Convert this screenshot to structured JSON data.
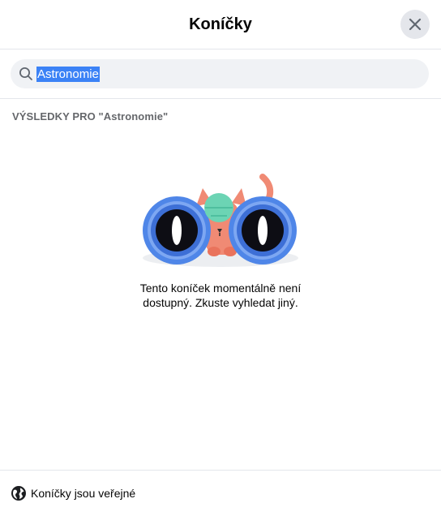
{
  "header": {
    "title": "Koníčky",
    "close_icon": "close-icon"
  },
  "search": {
    "value": "Astronomie",
    "icon": "search-icon"
  },
  "results": {
    "label": "VÝSLEDKY PRO \"Astronomie\""
  },
  "empty_state": {
    "illustration": "binoculars-cat-illustration",
    "line1": "Tento koníček momentálně není",
    "line2": "dostupný. Zkuste vyhledat jiný."
  },
  "footer": {
    "icon": "globe-icon",
    "text": "Koníčky jsou veřejné"
  },
  "colors": {
    "divider": "#e4e6eb",
    "close_bg": "#e4e6eb",
    "search_bg": "#f0f2f5",
    "selection": "#3b82f6",
    "secondary_text": "#65676b"
  }
}
